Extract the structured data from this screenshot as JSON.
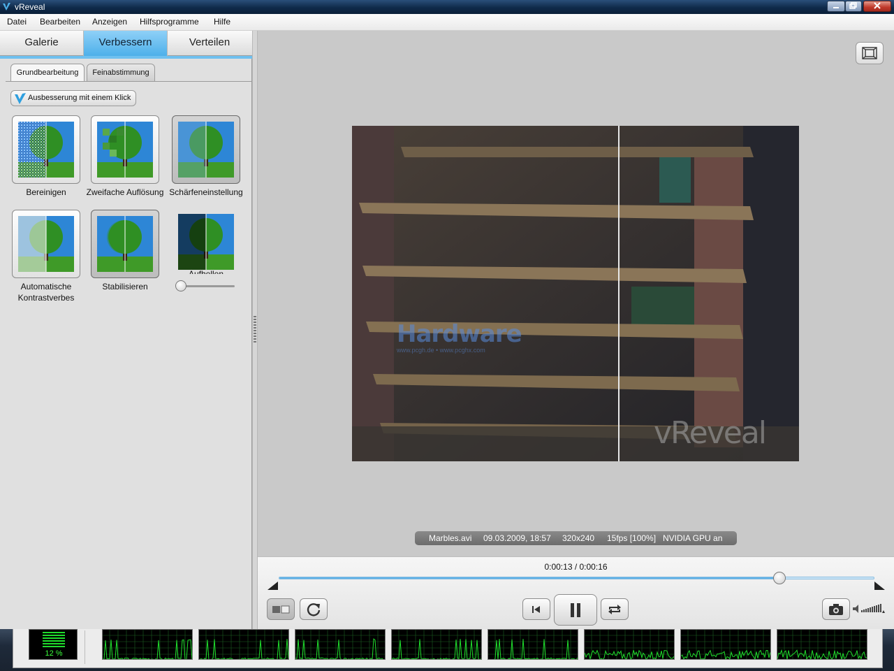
{
  "window": {
    "title": "vReveal"
  },
  "menu": [
    "Datei",
    "Bearbeiten",
    "Anzeigen",
    "Hilfsprogramme",
    "Hilfe"
  ],
  "main_tabs": [
    "Galerie",
    "Verbessern",
    "Verteilen"
  ],
  "sub_tabs": [
    "Grundbearbeitung",
    "Feinabstimmung"
  ],
  "one_click_label": "Ausbesserung mit einem Klick",
  "effects": [
    {
      "label": "Bereinigen",
      "selected": true
    },
    {
      "label": "Zweifache Auflösung",
      "selected": false
    },
    {
      "label": "Schärfeneinstellung",
      "selected": true
    },
    {
      "label": "Automatische Kontrastverbes",
      "selected": false
    },
    {
      "label": "Stabilisieren",
      "selected": true
    },
    {
      "label": "Aufhellen",
      "selected": false
    }
  ],
  "brighten_level": 0.0,
  "video": {
    "watermark_brand": "Hardware",
    "watermark_url": "www.pcgh.de • www.pcghx.com",
    "watermark_logo": "vReveal"
  },
  "info_bar": {
    "file": "Marbles.avi",
    "date": "09.03.2009, 18:57",
    "resolution": "320x240",
    "fps": "15fps [100%]",
    "gpu": "NVIDIA GPU an"
  },
  "playback": {
    "time": "0:00:13 / 0:00:16",
    "progress": 0.84
  },
  "cpu": {
    "usage_text": "12 %",
    "cores": 8
  },
  "colors": {
    "accent": "#4db0ea",
    "cpu_green": "#1fdc2c"
  }
}
